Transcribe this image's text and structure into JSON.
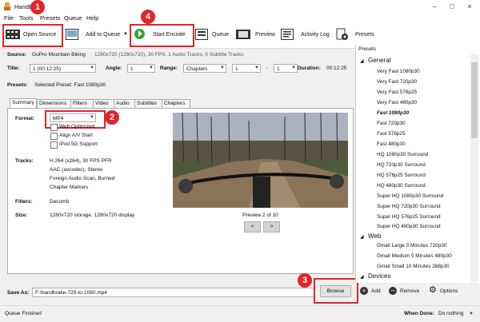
{
  "window": {
    "title": "HandBrake"
  },
  "menu": {
    "file": "File",
    "tools": "Tools",
    "presets": "Presets",
    "queue": "Queue",
    "help": "Help"
  },
  "toolbar": {
    "open_source": "Open Source",
    "add_to_queue": "Add to Queue",
    "start_encode": "Start Encode",
    "queue": "Queue",
    "preview": "Preview",
    "activity_log": "Activity Log",
    "presets": "Presets"
  },
  "badges": {
    "b1": "1",
    "b2": "2",
    "b3": "3",
    "b4": "4"
  },
  "source": {
    "label": "Source:",
    "name": "GoPro Mountain Biking",
    "info": "1280x720 (1280x720), 30 FPS, 1 Audio Tracks, 0 Subtitle Tracks"
  },
  "title_row": {
    "title_label": "Title:",
    "title_value": "1 (00:12:25)",
    "angle_label": "Angle:",
    "angle_value": "1",
    "range_label": "Range:",
    "range_value": "Chapters",
    "start": "1",
    "dash": "-",
    "end": "1",
    "duration_label": "Duration:",
    "duration_value": "00:12:25"
  },
  "presets_row": {
    "label": "Presets:",
    "value": "Selected Preset: Fast 1080p30"
  },
  "tabs": [
    "Summary",
    "Dimensions",
    "Filters",
    "Video",
    "Audio",
    "Subtitles",
    "Chapters"
  ],
  "summary": {
    "format_label": "Format:",
    "format_value": "MP4",
    "web_optimized": "Web Optimized",
    "align_av": "Align A/V Start",
    "ipod": "iPod 5G Support",
    "tracks_label": "Tracks:",
    "tracks": [
      "H.264 (x264), 30 FPS PFR",
      "AAC (avcodec), Stereo",
      "Foreign Audio Scan, Burned",
      "Chapter Markers"
    ],
    "filters_label": "Filters:",
    "filters_value": "Decomb",
    "size_label": "Size:",
    "size_value": "1280x720 storage, 1280x720 display",
    "preview_caption": "Preview 2 of 10",
    "prev": "<",
    "next": ">"
  },
  "save": {
    "label": "Save As:",
    "value": "F:\\handbrake-720-to-1080.mp4",
    "browse": "Browse"
  },
  "presets_panel": {
    "header": "Presets",
    "groups": [
      {
        "name": "General",
        "items": [
          "Very Fast 1080p30",
          "Very Fast 720p30",
          "Very Fast 576p25",
          "Very Fast 480p30",
          "Fast 1080p30",
          "Fast 720p30",
          "Fast 576p25",
          "Fast 480p30",
          "HQ 1080p30 Surround",
          "HQ 720p30 Surround",
          "HQ 576p25 Surround",
          "HQ 480p30 Surround",
          "Super HQ 1080p30 Surround",
          "Super HQ 720p30 Surround",
          "Super HQ 576p25 Surround",
          "Super HQ 480p30 Surround"
        ]
      },
      {
        "name": "Web",
        "items": [
          "Gmail Large 3 Minutes 720p30",
          "Gmail Medium 5 Minutes 480p30",
          "Gmail Small 10 Minutes 288p30"
        ]
      },
      {
        "name": "Devices",
        "items": []
      }
    ],
    "add": "Add",
    "remove": "Remove",
    "options": "Options"
  },
  "status": {
    "left": "Queue Finished",
    "when_done_label": "When Done:",
    "when_done_value": "Do nothing"
  },
  "colors": {
    "highlight": "#e0262b",
    "accent_green": "#3aa23a"
  }
}
